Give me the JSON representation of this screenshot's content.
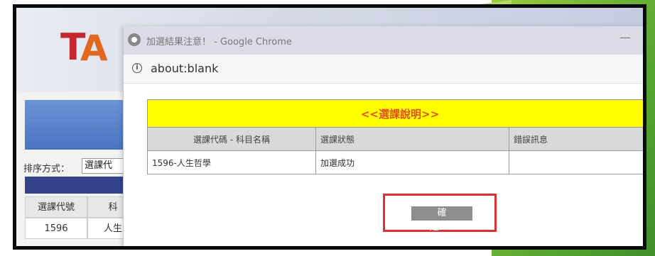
{
  "background_page": {
    "sort_label": "排序方式：",
    "sort_value": "選課代",
    "table_headers": [
      "選課代號",
      "科"
    ],
    "table_row": [
      "1596",
      "人生"
    ]
  },
  "popup": {
    "window_title": "加選結果注意！ - Google Chrome",
    "minimize_label": "—",
    "url": "about:blank",
    "info_title": "<<選課說明>>",
    "columns": [
      "選課代碼 - 科目名稱",
      "選課狀態",
      "錯誤訊息"
    ],
    "rows": [
      {
        "course": "1596-人生哲學",
        "status": "加選成功",
        "error": ""
      }
    ],
    "confirm_label": "確定"
  },
  "colors": {
    "highlight_yellow": "#ffff00",
    "title_red": "#e44d1c",
    "annotation_red": "#e03030",
    "slide_green": "#5aa832"
  },
  "icons": [
    "chrome-icon",
    "info-icon"
  ]
}
